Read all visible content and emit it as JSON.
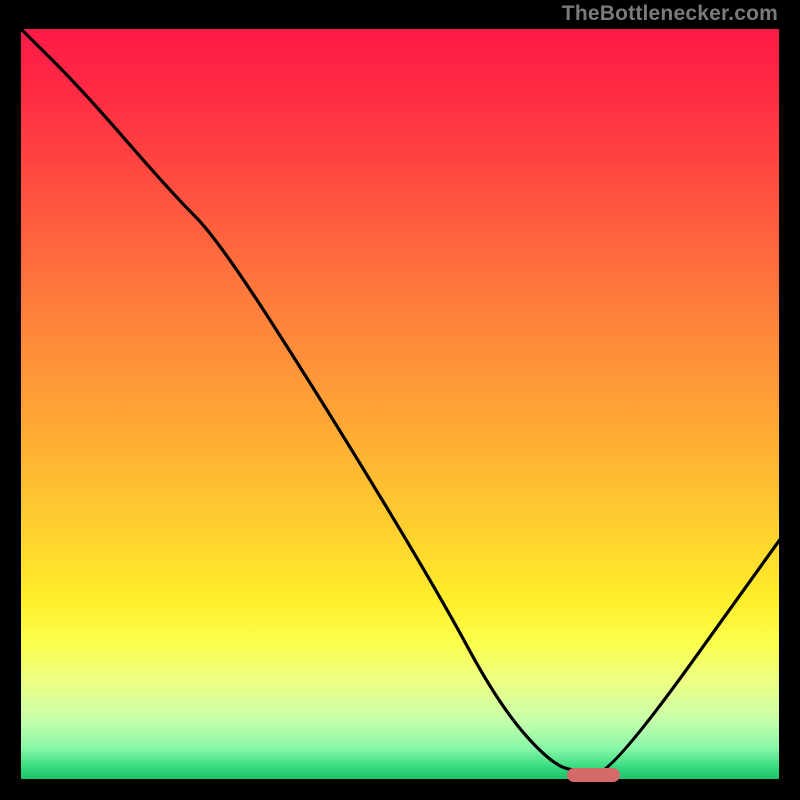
{
  "watermark": "TheBottlenecker.com",
  "chart_data": {
    "type": "line",
    "title": "",
    "xlabel": "",
    "ylabel": "",
    "xlim": [
      0,
      100
    ],
    "ylim": [
      0,
      100
    ],
    "series": [
      {
        "name": "bottleneck-curve",
        "x": [
          0,
          8,
          20,
          26,
          40,
          55,
          63,
          70,
          74,
          78,
          100
        ],
        "values": [
          100,
          92,
          78,
          72,
          50,
          25,
          10,
          2,
          1,
          1,
          32
        ]
      }
    ],
    "optimum_marker": {
      "x_start": 72,
      "x_end": 79,
      "y": 0.7
    },
    "background_gradient": {
      "top": "#ff1a46",
      "mid": "#ffd42e",
      "bottom": "#1ec06a"
    },
    "frame_color": "#000000"
  }
}
